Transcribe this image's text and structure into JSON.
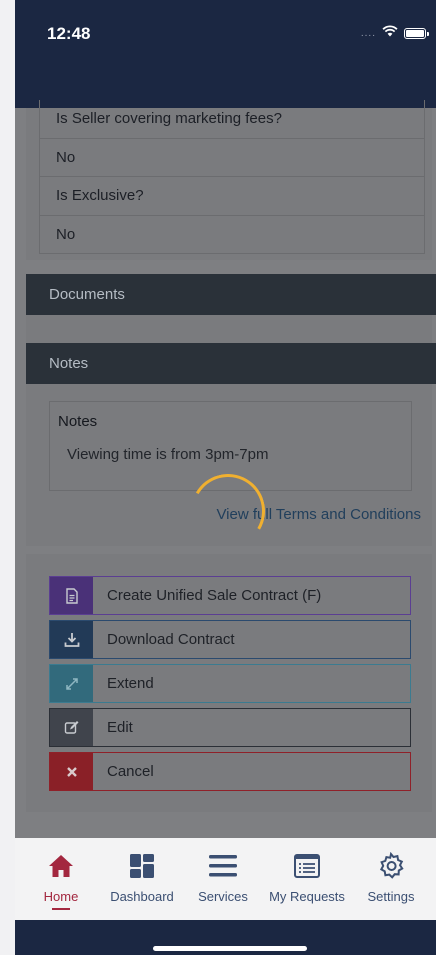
{
  "status_bar": {
    "time": "12:48",
    "signal": "....",
    "icons": [
      "wifi-icon",
      "battery-icon"
    ]
  },
  "details": {
    "rows": [
      {
        "question": "Is Seller covering marketing fees?",
        "answer": "No"
      },
      {
        "question": "Is Exclusive?",
        "answer": "No"
      }
    ]
  },
  "sections": {
    "documents": "Documents",
    "notes": "Notes"
  },
  "notes": {
    "title": "Notes",
    "text": "Viewing time is from 3pm-7pm"
  },
  "terms_link": "View full Terms and Conditions",
  "actions": [
    {
      "label": "Create Unified Sale Contract (F)",
      "icon": "document-icon",
      "color": "#5b3e92"
    },
    {
      "label": "Download Contract",
      "icon": "download-icon",
      "color": "#2b4a6e"
    },
    {
      "label": "Extend",
      "icon": "expand-icon",
      "color": "#3b7b90"
    },
    {
      "label": "Edit",
      "icon": "edit-icon",
      "color": "#2b2f36"
    },
    {
      "label": "Cancel",
      "icon": "close-icon",
      "color": "#8f2129"
    }
  ],
  "tabs": [
    {
      "label": "Home",
      "icon": "home-icon",
      "active": true
    },
    {
      "label": "Dashboard",
      "icon": "dashboard-icon",
      "active": false
    },
    {
      "label": "Services",
      "icon": "menu-icon",
      "active": false
    },
    {
      "label": "My Requests",
      "icon": "list-icon",
      "active": false
    },
    {
      "label": "Settings",
      "icon": "gear-icon",
      "active": false
    }
  ],
  "colors": {
    "header_bg": "#1b2742",
    "section_head_bg": "#2a3139",
    "overlay_bg": "#7e7f82",
    "spinner": "#f0b030",
    "active_tab": "#a3273f",
    "tab_text": "#3b4f72"
  }
}
